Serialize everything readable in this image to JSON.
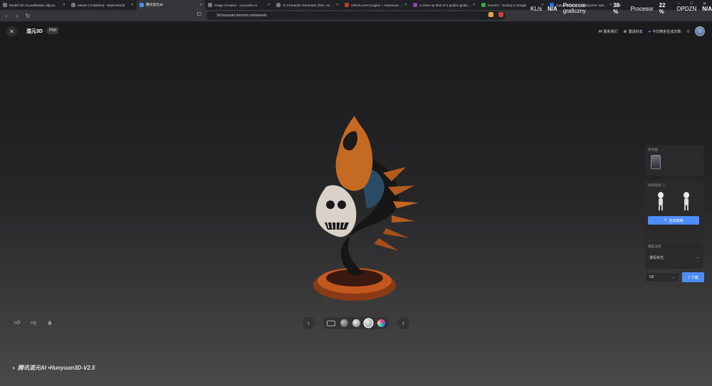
{
  "browser": {
    "tabs": [
      {
        "title": "Modeli 3D na podstawie zdjęcia",
        "active": false
      },
      {
        "title": "Maxim | Published - MakerWorld",
        "active": false
      },
      {
        "title": "腾讯混元3D",
        "active": true
      },
      {
        "title": "Image Creation - Leonardo.Ai",
        "active": false
      },
      {
        "title": "AI Character Generator (free, no sign...",
        "active": false
      },
      {
        "title": "URVILLAIN Imagine – Advanced AI...",
        "active": false
      },
      {
        "title": "A close-up shot of a golden globe ...",
        "active": false
      },
      {
        "title": "Numerz - Szukaj w Google",
        "active": false
      },
      {
        "title": "Optymalizacja – Artystyczne zastosowa...",
        "active": false
      }
    ],
    "url": "3d.hunyuan.tencent.com/assets",
    "new_tab": "+",
    "window_controls": [
      "–",
      "□",
      "✕"
    ]
  },
  "system_overlay": {
    "network_label": "KL/s",
    "network_value": "N/A",
    "gpu_label": "Procesor graficzny",
    "gpu_value": "38 %",
    "cpu_label": "Procesor",
    "cpu_value": "22 %",
    "ram_label": "OPDZN",
    "ram_value": "N/A"
  },
  "header": {
    "brand": "混元3D",
    "badge": "PBR",
    "contact": "联系我们",
    "invite": "邀请好友",
    "remaining_label": "今日剩余生成次数：",
    "remaining_value": "0"
  },
  "panel": {
    "reference_label": "参考图",
    "action_label": "动作驱动",
    "auto_rig_button": "自动绑骨",
    "render_label": "模型渲染",
    "render_value": "漫反射光",
    "format_value": "Glf",
    "download_button": "下载"
  },
  "toolbar": {
    "prev": "‹",
    "next": "›"
  },
  "footer": {
    "logo_text": "腾讯混元AI •Hunyuan3D-V2.5"
  },
  "colors": {
    "accent": "#4e8df7",
    "panel_bg": "#2a2a2c",
    "stage_top": "#1b1b1d",
    "stage_bottom": "#4a4a4a"
  }
}
